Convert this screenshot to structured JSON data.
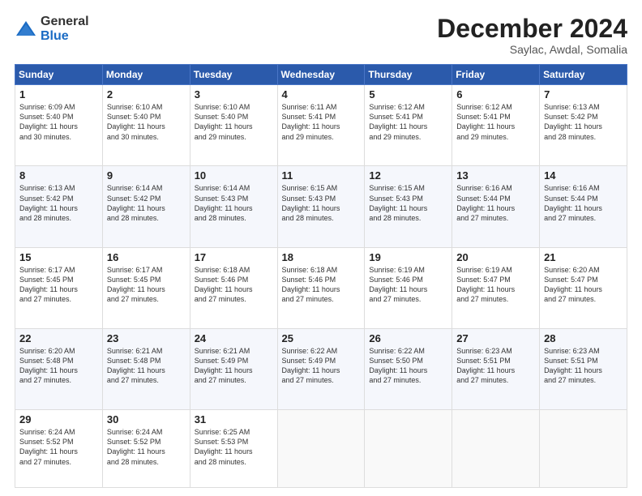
{
  "logo": {
    "general": "General",
    "blue": "Blue"
  },
  "header": {
    "month": "December 2024",
    "location": "Saylac, Awdal, Somalia"
  },
  "days": [
    "Sunday",
    "Monday",
    "Tuesday",
    "Wednesday",
    "Thursday",
    "Friday",
    "Saturday"
  ],
  "weeks": [
    [
      {
        "day": "1",
        "sunrise": "6:09 AM",
        "sunset": "5:40 PM",
        "daylight": "11 hours and 30 minutes."
      },
      {
        "day": "2",
        "sunrise": "6:10 AM",
        "sunset": "5:40 PM",
        "daylight": "11 hours and 30 minutes."
      },
      {
        "day": "3",
        "sunrise": "6:10 AM",
        "sunset": "5:40 PM",
        "daylight": "11 hours and 29 minutes."
      },
      {
        "day": "4",
        "sunrise": "6:11 AM",
        "sunset": "5:41 PM",
        "daylight": "11 hours and 29 minutes."
      },
      {
        "day": "5",
        "sunrise": "6:12 AM",
        "sunset": "5:41 PM",
        "daylight": "11 hours and 29 minutes."
      },
      {
        "day": "6",
        "sunrise": "6:12 AM",
        "sunset": "5:41 PM",
        "daylight": "11 hours and 29 minutes."
      },
      {
        "day": "7",
        "sunrise": "6:13 AM",
        "sunset": "5:42 PM",
        "daylight": "11 hours and 28 minutes."
      }
    ],
    [
      {
        "day": "8",
        "sunrise": "6:13 AM",
        "sunset": "5:42 PM",
        "daylight": "11 hours and 28 minutes."
      },
      {
        "day": "9",
        "sunrise": "6:14 AM",
        "sunset": "5:42 PM",
        "daylight": "11 hours and 28 minutes."
      },
      {
        "day": "10",
        "sunrise": "6:14 AM",
        "sunset": "5:43 PM",
        "daylight": "11 hours and 28 minutes."
      },
      {
        "day": "11",
        "sunrise": "6:15 AM",
        "sunset": "5:43 PM",
        "daylight": "11 hours and 28 minutes."
      },
      {
        "day": "12",
        "sunrise": "6:15 AM",
        "sunset": "5:43 PM",
        "daylight": "11 hours and 28 minutes."
      },
      {
        "day": "13",
        "sunrise": "6:16 AM",
        "sunset": "5:44 PM",
        "daylight": "11 hours and 27 minutes."
      },
      {
        "day": "14",
        "sunrise": "6:16 AM",
        "sunset": "5:44 PM",
        "daylight": "11 hours and 27 minutes."
      }
    ],
    [
      {
        "day": "15",
        "sunrise": "6:17 AM",
        "sunset": "5:45 PM",
        "daylight": "11 hours and 27 minutes."
      },
      {
        "day": "16",
        "sunrise": "6:17 AM",
        "sunset": "5:45 PM",
        "daylight": "11 hours and 27 minutes."
      },
      {
        "day": "17",
        "sunrise": "6:18 AM",
        "sunset": "5:46 PM",
        "daylight": "11 hours and 27 minutes."
      },
      {
        "day": "18",
        "sunrise": "6:18 AM",
        "sunset": "5:46 PM",
        "daylight": "11 hours and 27 minutes."
      },
      {
        "day": "19",
        "sunrise": "6:19 AM",
        "sunset": "5:46 PM",
        "daylight": "11 hours and 27 minutes."
      },
      {
        "day": "20",
        "sunrise": "6:19 AM",
        "sunset": "5:47 PM",
        "daylight": "11 hours and 27 minutes."
      },
      {
        "day": "21",
        "sunrise": "6:20 AM",
        "sunset": "5:47 PM",
        "daylight": "11 hours and 27 minutes."
      }
    ],
    [
      {
        "day": "22",
        "sunrise": "6:20 AM",
        "sunset": "5:48 PM",
        "daylight": "11 hours and 27 minutes."
      },
      {
        "day": "23",
        "sunrise": "6:21 AM",
        "sunset": "5:48 PM",
        "daylight": "11 hours and 27 minutes."
      },
      {
        "day": "24",
        "sunrise": "6:21 AM",
        "sunset": "5:49 PM",
        "daylight": "11 hours and 27 minutes."
      },
      {
        "day": "25",
        "sunrise": "6:22 AM",
        "sunset": "5:49 PM",
        "daylight": "11 hours and 27 minutes."
      },
      {
        "day": "26",
        "sunrise": "6:22 AM",
        "sunset": "5:50 PM",
        "daylight": "11 hours and 27 minutes."
      },
      {
        "day": "27",
        "sunrise": "6:23 AM",
        "sunset": "5:51 PM",
        "daylight": "11 hours and 27 minutes."
      },
      {
        "day": "28",
        "sunrise": "6:23 AM",
        "sunset": "5:51 PM",
        "daylight": "11 hours and 27 minutes."
      }
    ],
    [
      {
        "day": "29",
        "sunrise": "6:24 AM",
        "sunset": "5:52 PM",
        "daylight": "11 hours and 27 minutes."
      },
      {
        "day": "30",
        "sunrise": "6:24 AM",
        "sunset": "5:52 PM",
        "daylight": "11 hours and 28 minutes."
      },
      {
        "day": "31",
        "sunrise": "6:25 AM",
        "sunset": "5:53 PM",
        "daylight": "11 hours and 28 minutes."
      },
      null,
      null,
      null,
      null
    ]
  ]
}
